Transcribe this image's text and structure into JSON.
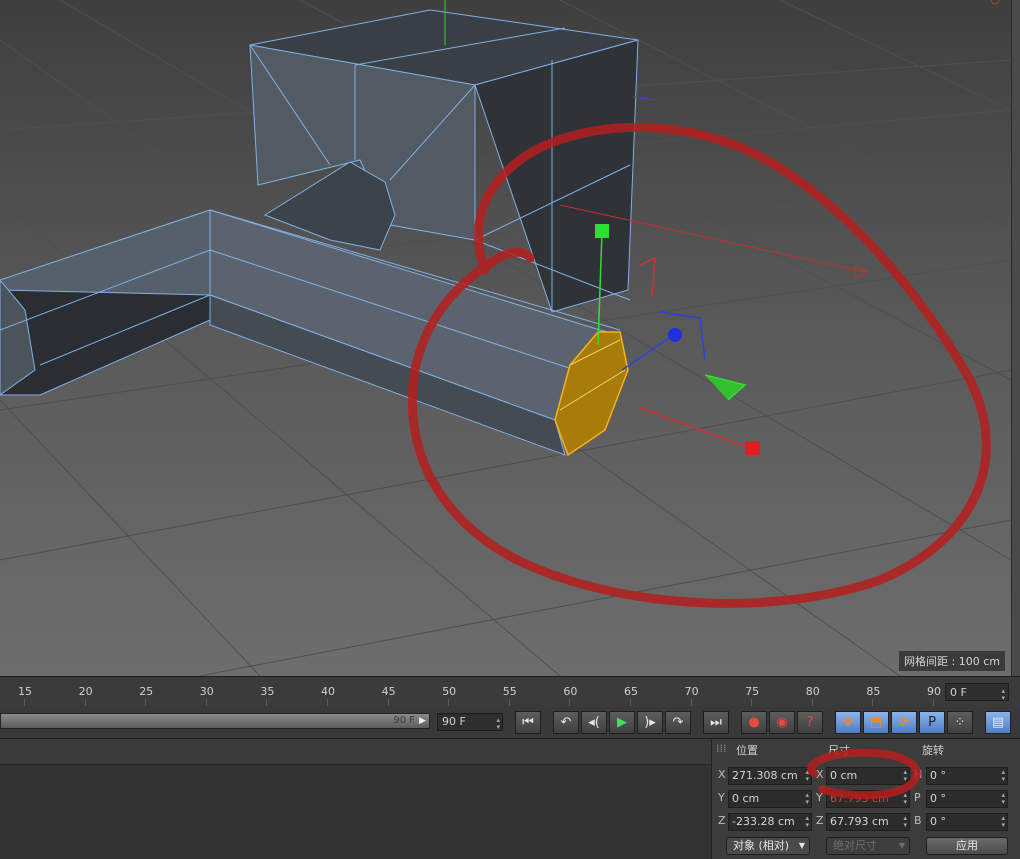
{
  "viewport": {
    "grid_spacing": "网格间距 : 100 cm"
  },
  "timeline": {
    "ticks": [
      "15",
      "20",
      "25",
      "30",
      "35",
      "40",
      "45",
      "50",
      "55",
      "60",
      "65",
      "70",
      "75",
      "80",
      "85",
      "90"
    ],
    "current_frame": "0 F"
  },
  "transport": {
    "scrub_end_label": "90 F",
    "end_frame": "90 F",
    "buttons": [
      {
        "name": "go-to-start",
        "glyph": "⏮"
      },
      {
        "name": "previous-keyframe",
        "glyph": "↶"
      },
      {
        "name": "previous-frame",
        "glyph": "◂("
      },
      {
        "name": "play",
        "glyph": "▶"
      },
      {
        "name": "next-frame",
        "glyph": ")▸"
      },
      {
        "name": "next-keyframe",
        "glyph": "↷"
      },
      {
        "name": "go-to-end",
        "glyph": "⏭"
      },
      {
        "name": "record-keys",
        "glyph": "●"
      },
      {
        "name": "autokey",
        "glyph": "◉"
      },
      {
        "name": "keyframe-help",
        "glyph": "?"
      },
      {
        "name": "key-position",
        "glyph": "✥"
      },
      {
        "name": "key-scale",
        "glyph": "⬒"
      },
      {
        "name": "key-rotation",
        "glyph": "⟳"
      },
      {
        "name": "key-parameter",
        "glyph": "P"
      },
      {
        "name": "key-pla",
        "glyph": "⁘"
      },
      {
        "name": "timeline-window",
        "glyph": "▤"
      }
    ]
  },
  "coordinates": {
    "position_header": "位置",
    "size_header": "尺寸",
    "rotation_header": "旋转",
    "rows": [
      {
        "pos_axis": "X",
        "pos_value": "271.308 cm",
        "size_axis": "X",
        "size_value": "0 cm",
        "rot_axis": "H",
        "rot_value": "0 °"
      },
      {
        "pos_axis": "Y",
        "pos_value": "0 cm",
        "size_axis": "Y",
        "size_value": "67.793 cm",
        "rot_axis": "P",
        "rot_value": "0 °"
      },
      {
        "pos_axis": "Z",
        "pos_value": "-233.28 cm",
        "size_axis": "Z",
        "size_value": "67.793 cm",
        "rot_axis": "B",
        "rot_value": "0 °"
      }
    ],
    "mode_dropdown": "对象 (相对)",
    "size_mode_dropdown": "绝对尺寸",
    "apply_button": "应用"
  },
  "colors": {
    "selection_face": "#c9950a",
    "annotation": "#b51e1e",
    "axis_x": "#e02020",
    "axis_y": "#20e020",
    "axis_z": "#2030e0",
    "mesh_edge": "#7fb0e8"
  }
}
